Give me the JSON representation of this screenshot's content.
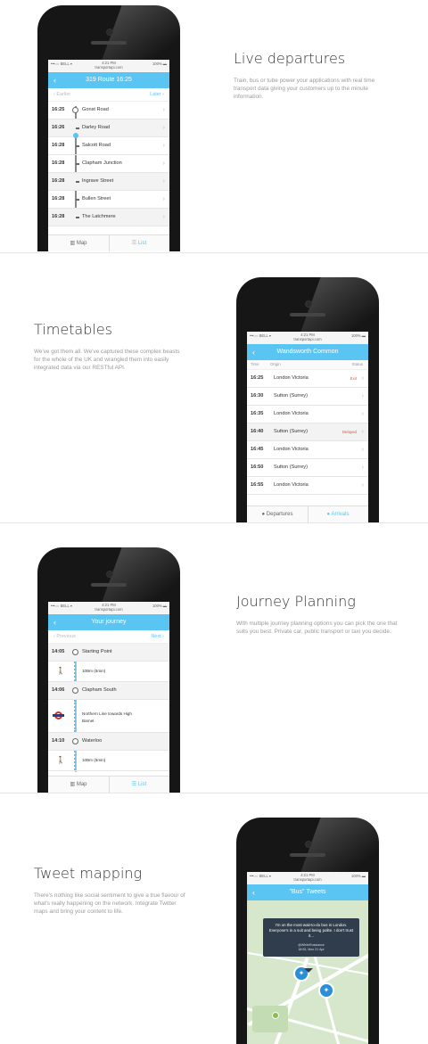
{
  "sections": [
    {
      "heading": "Live departures",
      "description": "Train, bus or tube power your applications with real time transport data giving your customers up to the minute information."
    },
    {
      "heading": "Timetables",
      "description": "We've got them all. We've captured these complex beasts for the whole of the UK and wrangled them into easily integrated data via our RESTful API."
    },
    {
      "heading": "Journey Planning",
      "description": "With multiple journey planning options you can pick the one that suits you best. Private car, public transport or taxi you decide."
    },
    {
      "heading": "Tweet mapping",
      "description": "There's nothing like social sentiment to give a true flavour of what's really happening on the network. Integrate Twitter maps and bring your content to life."
    }
  ],
  "status": {
    "carrier": "•••○○ BELL ▾",
    "time": "4:21 PM",
    "site": "transportapi.com",
    "battery": "100% ▬"
  },
  "phone1": {
    "title": "319 Route 16:25",
    "earlier": "‹ Earlier",
    "later": "Later ›",
    "stops": [
      {
        "time": "16:25",
        "name": "Gonst Road"
      },
      {
        "time": "16:26",
        "name": "Darley Road"
      },
      {
        "time": "16:28",
        "name": "Salcott Road"
      },
      {
        "time": "16:28",
        "name": "Clapham Junction"
      },
      {
        "time": "16:28",
        "name": "Ingrave Street"
      },
      {
        "time": "16:28",
        "name": "Bullen Street"
      },
      {
        "time": "16:28",
        "name": "The Latchmere"
      }
    ],
    "tab_map": "Map",
    "tab_list": "List"
  },
  "phone2": {
    "title": "Wandsworth Common",
    "col_time": "Time",
    "col_origin": "Origin",
    "col_status": "Status",
    "rows": [
      {
        "time": "16:25",
        "origin": "London Victoria",
        "status": "Exit"
      },
      {
        "time": "16:30",
        "origin": "Sutton (Surrey)",
        "status": ""
      },
      {
        "time": "16:35",
        "origin": "London Victoria",
        "status": ""
      },
      {
        "time": "16:40",
        "origin": "Sutton (Surrey)",
        "status": "Delayed"
      },
      {
        "time": "16:45",
        "origin": "London Victoria",
        "status": ""
      },
      {
        "time": "16:50",
        "origin": "Sutton (Surrey)",
        "status": ""
      },
      {
        "time": "16:55",
        "origin": "London Victoria",
        "status": ""
      }
    ],
    "tab_departures": "Departures",
    "tab_arrivals": "Arrivals"
  },
  "phone3": {
    "title": "Your journey",
    "previous": "‹ Previous",
    "next": "Next ›",
    "steps": [
      {
        "time": "14:05",
        "label": "Starting Point"
      },
      {
        "time": "",
        "label": "10Bm (5min)"
      },
      {
        "time": "14:06",
        "label": "Clapham South"
      },
      {
        "time": "",
        "label": "Northern Line towards High Barnet"
      },
      {
        "time": "14:10",
        "label": "Waterloo"
      },
      {
        "time": "",
        "label": "10Bm (5min)"
      }
    ],
    "tab_map": "Map",
    "tab_list": "List"
  },
  "phone4": {
    "title": "\"Bus\" Tweets",
    "tweet": "I'm on the most wait-to-do bus in London. Everyone's in a suit and being polite. I don't trust it...",
    "handle": "@WhiteRussiance",
    "date": "18:05, Mon 21 Apr"
  },
  "colors": {
    "accent": "#5ac4f2",
    "delay": "#e05050",
    "tooltip": "#2f3d4c",
    "map": "#d6e7cc",
    "twitter": "#2a8fd8"
  }
}
